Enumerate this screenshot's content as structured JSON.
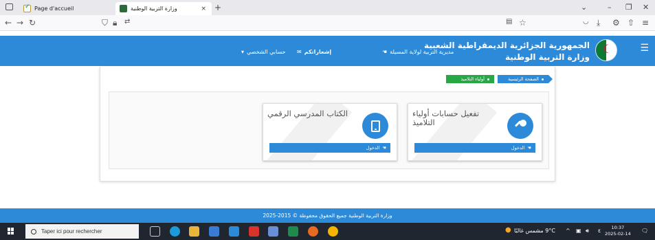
{
  "browser": {
    "tabs": [
      {
        "title": "Page d'accueil"
      },
      {
        "title": "وزارة التربية الوطنية"
      }
    ],
    "new_tab": "+",
    "close": "×"
  },
  "header": {
    "title_line1": "الجمهورية الجزائرية الديمقراطية الشعبية",
    "title_line2": "وزارة التربية الوطنية",
    "directorate": "مديرية التربية لولاية المسيلة",
    "notifications": "إشعاراتكم",
    "account": "حسابي الشخصي"
  },
  "breadcrumb": {
    "home": "الصفحة الرئيسية",
    "current": "أولياء التلاميذ"
  },
  "cards": [
    {
      "title": "تفعيل حسابات أولياء التلاميذ",
      "button": "الدخول",
      "icon": "key-icon"
    },
    {
      "title": "الكتاب المدرسي الرقمي",
      "button": "الدخول",
      "icon": "tablet-icon"
    }
  ],
  "footer": {
    "text": "وزارة التربية الوطنية جميع الحقوق محفوظة © 2015-2025"
  },
  "taskbar": {
    "search_placeholder": "Taper ici pour rechercher",
    "weather": "9°C مشمس غالبًا",
    "time": "10:37",
    "date": "2025-02-14"
  },
  "colors": {
    "primary": "#2c8ad9",
    "success": "#28a745"
  }
}
